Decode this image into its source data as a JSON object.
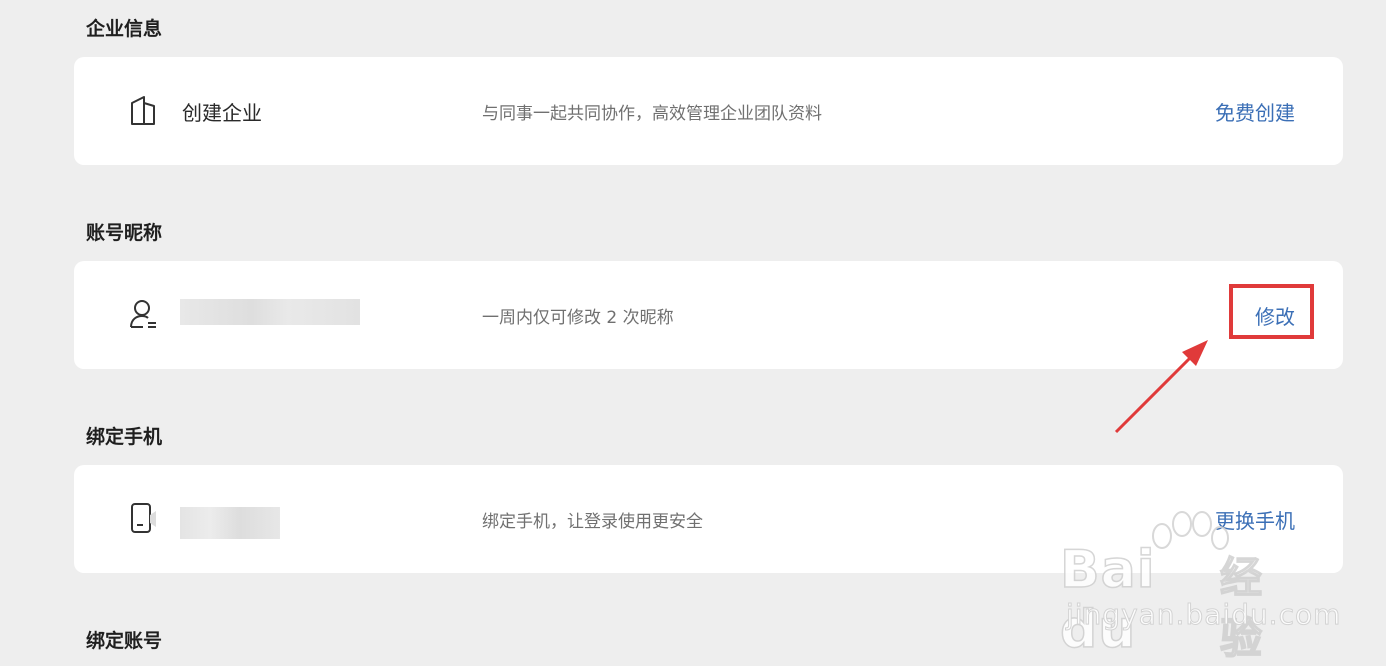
{
  "sections": [
    {
      "title": "企业信息",
      "row": {
        "icon": "building-icon",
        "name": "创建企业",
        "description": "与同事一起共同协作，高效管理企业团队资料",
        "action": "免费创建"
      }
    },
    {
      "title": "账号昵称",
      "row": {
        "icon": "user-icon",
        "name": "",
        "description": "一周内仅可修改 2 次昵称",
        "action": "修改"
      }
    },
    {
      "title": "绑定手机",
      "row": {
        "icon": "phone-icon",
        "name": "",
        "description": "绑定手机，让登录使用更安全",
        "action": "更换手机"
      }
    },
    {
      "title": "绑定账号"
    }
  ],
  "annotation": {
    "highlight_color": "#e03a3a"
  },
  "watermark": {
    "brand": "Bai du",
    "cn": "经验",
    "url": "jingyan.baidu.com"
  },
  "colors": {
    "link": "#3b6fb6",
    "background": "#eeeeee",
    "card": "#ffffff"
  }
}
